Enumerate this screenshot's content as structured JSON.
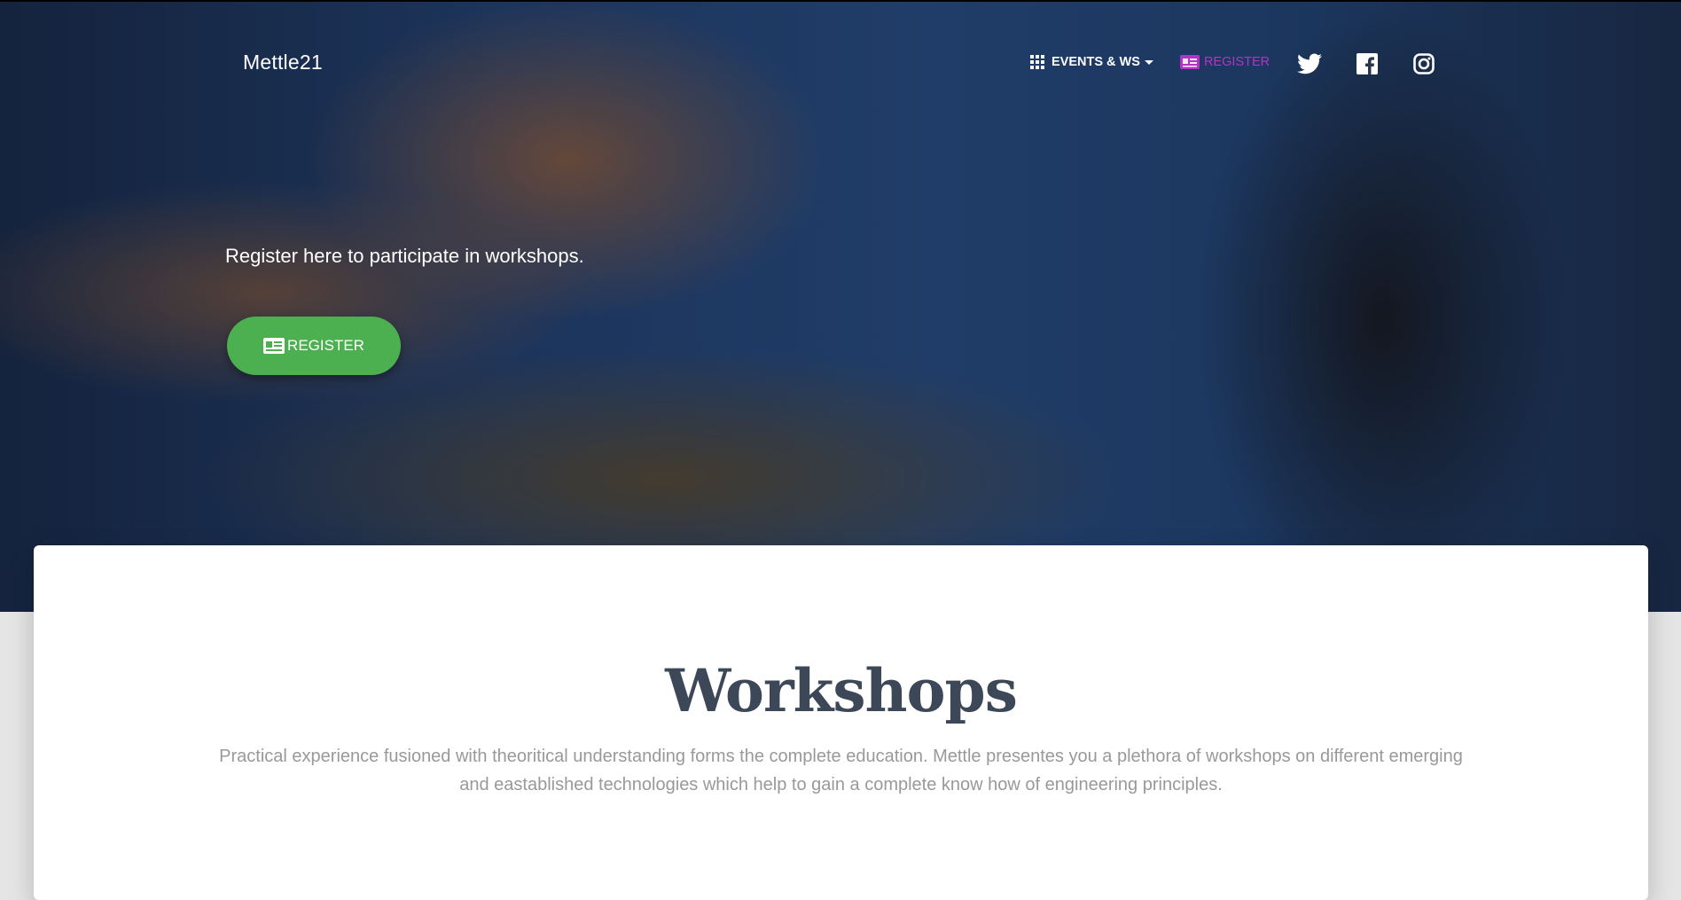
{
  "navbar": {
    "brand": "Mettle21",
    "events_label": "EVENTS & WS",
    "register_label": "REGISTER",
    "social": [
      "twitter-icon",
      "facebook-icon",
      "instagram-icon"
    ]
  },
  "hero": {
    "text": "Register here to participate in workshops.",
    "button_label": "REGISTER",
    "button_color": "#4caf50"
  },
  "workshops": {
    "title": "Workshops",
    "description": "Practical experience fusioned with theoritical understanding forms the complete education. Mettle presentes you a plethora of workshops on different emerging and eastablished technologies which help to gain a complete know how of engineering principles."
  },
  "colors": {
    "accent": "#b334c4",
    "title": "#3c4858",
    "muted": "#999999"
  }
}
